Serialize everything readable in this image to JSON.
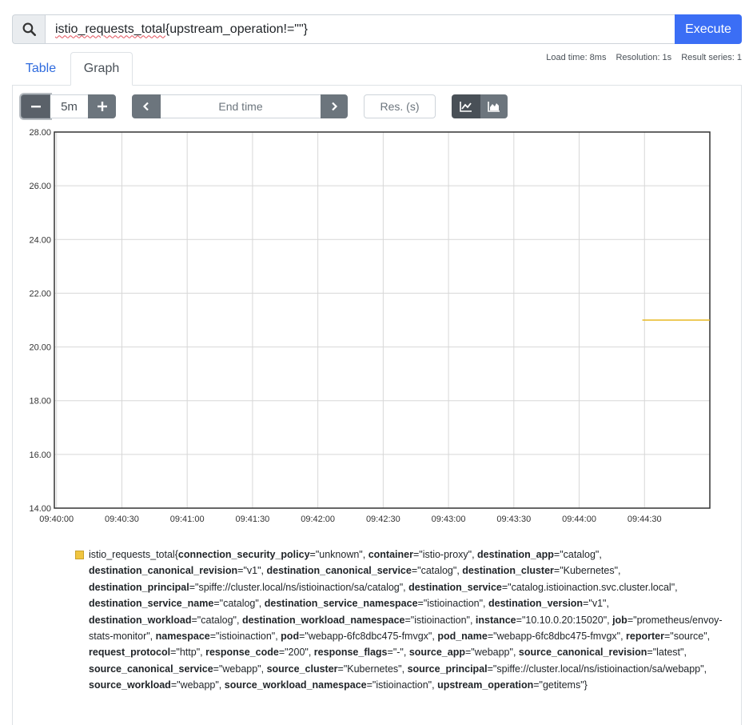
{
  "query": {
    "metric": "istio_requests_total",
    "rest": "{upstream_operation!=\"\"}",
    "execute_label": "Execute"
  },
  "tabs": [
    {
      "label": "Table",
      "active": false
    },
    {
      "label": "Graph",
      "active": true
    }
  ],
  "stats": {
    "load_time": "Load time: 8ms",
    "resolution": "Resolution: 1s",
    "result_series": "Result series: 1"
  },
  "controls": {
    "range": "5m",
    "minus_label": "−",
    "plus_label": "+",
    "end_time_placeholder": "End time",
    "resolution_placeholder": "Res. (s)",
    "stacked_active": "line"
  },
  "colors": {
    "accent": "#3b6ef5",
    "series": "#e8b923",
    "tab_link": "#2f6bde"
  },
  "chart_data": {
    "type": "line",
    "ylim": [
      14,
      28
    ],
    "yticks": [
      "14.00",
      "16.00",
      "18.00",
      "20.00",
      "22.00",
      "24.00",
      "26.00",
      "28.00"
    ],
    "xticks": [
      "09:40:00",
      "09:40:30",
      "09:41:00",
      "09:41:30",
      "09:42:00",
      "09:42:30",
      "09:43:00",
      "09:43:30",
      "09:44:00",
      "09:44:30"
    ],
    "xlim": [
      "09:39:59",
      "09:45:00"
    ],
    "grid": true,
    "series": [
      {
        "x": [
          "09:44:29",
          "09:45:00"
        ],
        "values": [
          21,
          21
        ]
      }
    ]
  },
  "legend": {
    "metric": "istio_requests_total",
    "labels": [
      {
        "key": "connection_security_policy",
        "value": "\"unknown\""
      },
      {
        "key": "container",
        "value": "\"istio-proxy\""
      },
      {
        "key": "destination_app",
        "value": "\"catalog\""
      },
      {
        "key": "destination_canonical_revision",
        "value": "\"v1\""
      },
      {
        "key": "destination_canonical_service",
        "value": "\"catalog\""
      },
      {
        "key": "destination_cluster",
        "value": "\"Kubernetes\""
      },
      {
        "key": "destination_principal",
        "value": "\"spiffe://cluster.local/ns/istioinaction/sa/catalog\""
      },
      {
        "key": "destination_service",
        "value": "\"catalog.istioinaction.svc.cluster.local\""
      },
      {
        "key": "destination_service_name",
        "value": "\"catalog\""
      },
      {
        "key": "destination_service_namespace",
        "value": "\"istioinaction\""
      },
      {
        "key": "destination_version",
        "value": "\"v1\""
      },
      {
        "key": "destination_workload",
        "value": "\"catalog\""
      },
      {
        "key": "destination_workload_namespace",
        "value": "\"istioinaction\""
      },
      {
        "key": "instance",
        "value": "\"10.10.0.20:15020\""
      },
      {
        "key": "job",
        "value": "\"prometheus/envoy-stats-monitor\""
      },
      {
        "key": "namespace",
        "value": "\"istioinaction\""
      },
      {
        "key": "pod",
        "value": "\"webapp-6fc8dbc475-fmvgx\""
      },
      {
        "key": "pod_name",
        "value": "\"webapp-6fc8dbc475-fmvgx\""
      },
      {
        "key": "reporter",
        "value": "\"source\""
      },
      {
        "key": "request_protocol",
        "value": "\"http\""
      },
      {
        "key": "response_code",
        "value": "\"200\""
      },
      {
        "key": "response_flags",
        "value": "\"-\""
      },
      {
        "key": "source_app",
        "value": "\"webapp\""
      },
      {
        "key": "source_canonical_revision",
        "value": "\"latest\""
      },
      {
        "key": "source_canonical_service",
        "value": "\"webapp\""
      },
      {
        "key": "source_cluster",
        "value": "\"Kubernetes\""
      },
      {
        "key": "source_principal",
        "value": "\"spiffe://cluster.local/ns/istioinaction/sa/webapp\""
      },
      {
        "key": "source_workload",
        "value": "\"webapp\""
      },
      {
        "key": "source_workload_namespace",
        "value": "\"istioinaction\""
      },
      {
        "key": "upstream_operation",
        "value": "\"getitems\""
      }
    ]
  }
}
